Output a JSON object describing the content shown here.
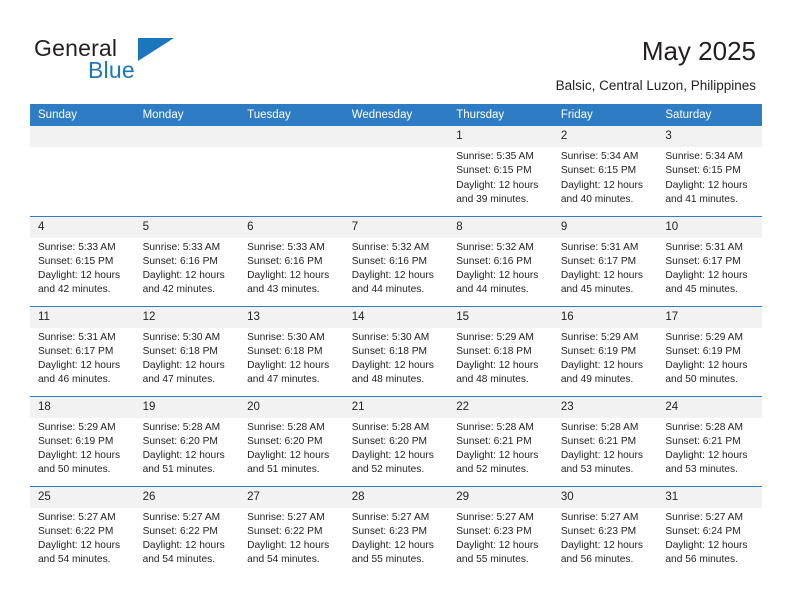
{
  "brand": {
    "word1": "General",
    "word2": "Blue",
    "flag_icon": "triangle-flag-icon",
    "accent_color": "#1c76bc"
  },
  "header": {
    "title": "May 2025",
    "subtitle": "Balsic, Central Luzon, Philippines"
  },
  "calendar": {
    "header_bg": "#2e7cc3",
    "daynum_bg": "#f2f2f2",
    "weekdays": [
      "Sunday",
      "Monday",
      "Tuesday",
      "Wednesday",
      "Thursday",
      "Friday",
      "Saturday"
    ],
    "weeks": [
      [
        {
          "day": "",
          "lines": []
        },
        {
          "day": "",
          "lines": []
        },
        {
          "day": "",
          "lines": []
        },
        {
          "day": "",
          "lines": []
        },
        {
          "day": "1",
          "lines": [
            "Sunrise: 5:35 AM",
            "Sunset: 6:15 PM",
            "Daylight: 12 hours",
            "and 39 minutes."
          ]
        },
        {
          "day": "2",
          "lines": [
            "Sunrise: 5:34 AM",
            "Sunset: 6:15 PM",
            "Daylight: 12 hours",
            "and 40 minutes."
          ]
        },
        {
          "day": "3",
          "lines": [
            "Sunrise: 5:34 AM",
            "Sunset: 6:15 PM",
            "Daylight: 12 hours",
            "and 41 minutes."
          ]
        }
      ],
      [
        {
          "day": "4",
          "lines": [
            "Sunrise: 5:33 AM",
            "Sunset: 6:15 PM",
            "Daylight: 12 hours",
            "and 42 minutes."
          ]
        },
        {
          "day": "5",
          "lines": [
            "Sunrise: 5:33 AM",
            "Sunset: 6:16 PM",
            "Daylight: 12 hours",
            "and 42 minutes."
          ]
        },
        {
          "day": "6",
          "lines": [
            "Sunrise: 5:33 AM",
            "Sunset: 6:16 PM",
            "Daylight: 12 hours",
            "and 43 minutes."
          ]
        },
        {
          "day": "7",
          "lines": [
            "Sunrise: 5:32 AM",
            "Sunset: 6:16 PM",
            "Daylight: 12 hours",
            "and 44 minutes."
          ]
        },
        {
          "day": "8",
          "lines": [
            "Sunrise: 5:32 AM",
            "Sunset: 6:16 PM",
            "Daylight: 12 hours",
            "and 44 minutes."
          ]
        },
        {
          "day": "9",
          "lines": [
            "Sunrise: 5:31 AM",
            "Sunset: 6:17 PM",
            "Daylight: 12 hours",
            "and 45 minutes."
          ]
        },
        {
          "day": "10",
          "lines": [
            "Sunrise: 5:31 AM",
            "Sunset: 6:17 PM",
            "Daylight: 12 hours",
            "and 45 minutes."
          ]
        }
      ],
      [
        {
          "day": "11",
          "lines": [
            "Sunrise: 5:31 AM",
            "Sunset: 6:17 PM",
            "Daylight: 12 hours",
            "and 46 minutes."
          ]
        },
        {
          "day": "12",
          "lines": [
            "Sunrise: 5:30 AM",
            "Sunset: 6:18 PM",
            "Daylight: 12 hours",
            "and 47 minutes."
          ]
        },
        {
          "day": "13",
          "lines": [
            "Sunrise: 5:30 AM",
            "Sunset: 6:18 PM",
            "Daylight: 12 hours",
            "and 47 minutes."
          ]
        },
        {
          "day": "14",
          "lines": [
            "Sunrise: 5:30 AM",
            "Sunset: 6:18 PM",
            "Daylight: 12 hours",
            "and 48 minutes."
          ]
        },
        {
          "day": "15",
          "lines": [
            "Sunrise: 5:29 AM",
            "Sunset: 6:18 PM",
            "Daylight: 12 hours",
            "and 48 minutes."
          ]
        },
        {
          "day": "16",
          "lines": [
            "Sunrise: 5:29 AM",
            "Sunset: 6:19 PM",
            "Daylight: 12 hours",
            "and 49 minutes."
          ]
        },
        {
          "day": "17",
          "lines": [
            "Sunrise: 5:29 AM",
            "Sunset: 6:19 PM",
            "Daylight: 12 hours",
            "and 50 minutes."
          ]
        }
      ],
      [
        {
          "day": "18",
          "lines": [
            "Sunrise: 5:29 AM",
            "Sunset: 6:19 PM",
            "Daylight: 12 hours",
            "and 50 minutes."
          ]
        },
        {
          "day": "19",
          "lines": [
            "Sunrise: 5:28 AM",
            "Sunset: 6:20 PM",
            "Daylight: 12 hours",
            "and 51 minutes."
          ]
        },
        {
          "day": "20",
          "lines": [
            "Sunrise: 5:28 AM",
            "Sunset: 6:20 PM",
            "Daylight: 12 hours",
            "and 51 minutes."
          ]
        },
        {
          "day": "21",
          "lines": [
            "Sunrise: 5:28 AM",
            "Sunset: 6:20 PM",
            "Daylight: 12 hours",
            "and 52 minutes."
          ]
        },
        {
          "day": "22",
          "lines": [
            "Sunrise: 5:28 AM",
            "Sunset: 6:21 PM",
            "Daylight: 12 hours",
            "and 52 minutes."
          ]
        },
        {
          "day": "23",
          "lines": [
            "Sunrise: 5:28 AM",
            "Sunset: 6:21 PM",
            "Daylight: 12 hours",
            "and 53 minutes."
          ]
        },
        {
          "day": "24",
          "lines": [
            "Sunrise: 5:28 AM",
            "Sunset: 6:21 PM",
            "Daylight: 12 hours",
            "and 53 minutes."
          ]
        }
      ],
      [
        {
          "day": "25",
          "lines": [
            "Sunrise: 5:27 AM",
            "Sunset: 6:22 PM",
            "Daylight: 12 hours",
            "and 54 minutes."
          ]
        },
        {
          "day": "26",
          "lines": [
            "Sunrise: 5:27 AM",
            "Sunset: 6:22 PM",
            "Daylight: 12 hours",
            "and 54 minutes."
          ]
        },
        {
          "day": "27",
          "lines": [
            "Sunrise: 5:27 AM",
            "Sunset: 6:22 PM",
            "Daylight: 12 hours",
            "and 54 minutes."
          ]
        },
        {
          "day": "28",
          "lines": [
            "Sunrise: 5:27 AM",
            "Sunset: 6:23 PM",
            "Daylight: 12 hours",
            "and 55 minutes."
          ]
        },
        {
          "day": "29",
          "lines": [
            "Sunrise: 5:27 AM",
            "Sunset: 6:23 PM",
            "Daylight: 12 hours",
            "and 55 minutes."
          ]
        },
        {
          "day": "30",
          "lines": [
            "Sunrise: 5:27 AM",
            "Sunset: 6:23 PM",
            "Daylight: 12 hours",
            "and 56 minutes."
          ]
        },
        {
          "day": "31",
          "lines": [
            "Sunrise: 5:27 AM",
            "Sunset: 6:24 PM",
            "Daylight: 12 hours",
            "and 56 minutes."
          ]
        }
      ]
    ]
  }
}
